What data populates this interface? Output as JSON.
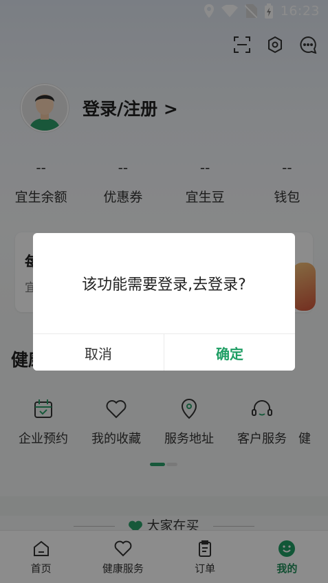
{
  "status_bar": {
    "time": "16:23",
    "icons": [
      "location-icon",
      "wifi-icon",
      "no-sim-icon",
      "battery-charging-icon"
    ]
  },
  "top_icons": [
    "scan-icon",
    "settings-icon",
    "message-icon"
  ],
  "profile": {
    "login_label": "登录/注册 >"
  },
  "stats": [
    {
      "value": "--",
      "label": "宜生余额"
    },
    {
      "value": "--",
      "label": "优惠券"
    },
    {
      "value": "--",
      "label": "宜生豆"
    },
    {
      "value": "--",
      "label": "钱包"
    }
  ],
  "promo": {
    "title_partial": "每",
    "subtitle_partial": "宜"
  },
  "health_section": {
    "title_partial": "健康"
  },
  "services": [
    {
      "label": "企业预约",
      "icon": "calendar-icon"
    },
    {
      "label": "我的收藏",
      "icon": "heart-icon"
    },
    {
      "label": "服务地址",
      "icon": "location-pin-icon"
    },
    {
      "label": "客户服务",
      "icon": "headset-icon"
    },
    {
      "label": "健",
      "icon": "more-icon"
    }
  ],
  "buying": {
    "label": "大家在买"
  },
  "tabbar": [
    {
      "label": "首页",
      "icon": "home-icon",
      "active": false
    },
    {
      "label": "健康服务",
      "icon": "heart-icon",
      "active": false
    },
    {
      "label": "订单",
      "icon": "clipboard-icon",
      "active": false
    },
    {
      "label": "我的",
      "icon": "smile-icon",
      "active": true
    }
  ],
  "dialog": {
    "message": "该功能需要登录,去登录?",
    "cancel_label": "取消",
    "confirm_label": "确定"
  },
  "colors": {
    "accent": "#1f9e64",
    "overlay": "rgba(0,0,0,0.45)"
  }
}
